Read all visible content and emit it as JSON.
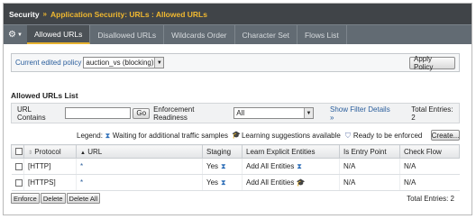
{
  "breadcrumb": {
    "root": "Security",
    "separator": "»",
    "section": "Application Security",
    "path": ": URLs : Allowed URLs"
  },
  "tabs": [
    {
      "label": "Allowed URLs",
      "active": true
    },
    {
      "label": "Disallowed URLs",
      "active": false
    },
    {
      "label": "Wildcards Order",
      "active": false
    },
    {
      "label": "Character Set",
      "active": false
    },
    {
      "label": "Flows List",
      "active": false
    }
  ],
  "policy": {
    "label": "Current edited policy",
    "selected": "auction_vs (blocking)",
    "apply_label": "Apply Policy"
  },
  "list": {
    "title": "Allowed URLs List"
  },
  "filter": {
    "url_contains_label": "URL Contains",
    "url_value": "",
    "go_label": "Go",
    "readiness_label": "Enforcement Readiness",
    "readiness_selected": "All",
    "show_filter_label": "Show Filter Details",
    "show_filter_arrow": "»",
    "total_entries_label": "Total Entries: 2"
  },
  "legend": {
    "label": "Legend:",
    "waiting": "Waiting for additional traffic samples",
    "learning": "Learning suggestions available",
    "ready": "Ready to be enforced",
    "create_label": "Create..."
  },
  "table": {
    "columns": {
      "protocol": "Protocol",
      "url": "URL",
      "staging": "Staging",
      "learn": "Learn Explicit Entities",
      "entry": "Is Entry Point",
      "flow": "Check Flow"
    },
    "rows": [
      {
        "protocol": "[HTTP]",
        "url": "*",
        "staging": "Yes",
        "learn": "Add All Entities",
        "entry": "N/A",
        "flow": "N/A"
      },
      {
        "protocol": "[HTTPS]",
        "url": "*",
        "staging": "Yes",
        "learn": "Add All Entities",
        "entry": "N/A",
        "flow": "N/A"
      }
    ]
  },
  "actions": {
    "enforce": "Enforce",
    "delete": "Delete",
    "delete_all": "Delete All",
    "total_entries": "Total Entries: 2"
  },
  "colors": {
    "breadcrumb_bg": "#404448",
    "tabs_bg": "#626b73",
    "accent": "#f0b830",
    "link": "#2a5e9c"
  },
  "icons": {
    "menu": "gear-icon",
    "waiting": "hourglass-icon",
    "learning": "graduation-cap-icon",
    "ready": "shield-icon"
  }
}
